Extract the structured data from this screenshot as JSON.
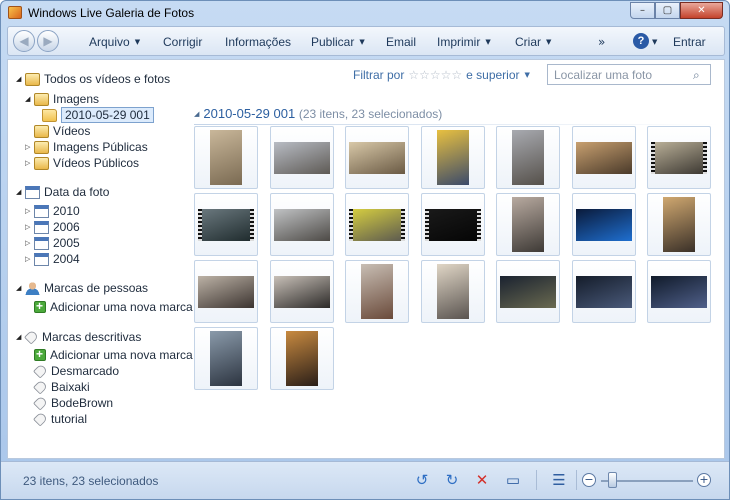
{
  "window": {
    "title": "Windows Live Galeria de Fotos",
    "minimize": "–",
    "maximize": "▢",
    "close": "✕"
  },
  "toolbar": {
    "back": "◀",
    "forward": "▶",
    "menus": [
      {
        "label": "Arquivo",
        "caret": true
      },
      {
        "label": "Corrigir",
        "caret": false
      },
      {
        "label": "Informações",
        "caret": false
      },
      {
        "label": "Publicar",
        "caret": true
      },
      {
        "label": "Email",
        "caret": false
      },
      {
        "label": "Imprimir",
        "caret": true
      },
      {
        "label": "Criar",
        "caret": true
      }
    ],
    "overflow": "»",
    "help": "?",
    "signin": "Entrar"
  },
  "filter": {
    "label": "Filtrar por",
    "stars": "☆☆☆☆☆",
    "qualifier": "e superior"
  },
  "search": {
    "placeholder": "Localizar uma foto"
  },
  "tree": {
    "all": "Todos os vídeos e fotos",
    "images": "Imagens",
    "selected_folder": "2010-05-29 001",
    "videos": "Vídeos",
    "public_images": "Imagens Públicas",
    "public_videos": "Vídeos Públicos",
    "date_header": "Data da foto",
    "years": [
      "2010",
      "2006",
      "2005",
      "2004"
    ],
    "people_header": "Marcas de pessoas",
    "people_add": "Adicionar uma nova marca",
    "desc_header": "Marcas descritivas",
    "desc_add": "Adicionar uma nova marca",
    "desc_tags": [
      "Desmarcado",
      "Baixaki",
      "BodeBrown",
      "tutorial"
    ]
  },
  "group": {
    "title": "2010-05-29 001",
    "subtitle": "(23 itens, 23 selecionados)"
  },
  "thumbnails": [
    {
      "orient": "portrait",
      "video": false,
      "colors": [
        "#c9b79a",
        "#7a6a52"
      ]
    },
    {
      "orient": "landscape",
      "video": false,
      "colors": [
        "#b8bcc4",
        "#5e5a55"
      ]
    },
    {
      "orient": "landscape",
      "video": false,
      "colors": [
        "#d8c8a8",
        "#6a5a44"
      ]
    },
    {
      "orient": "portrait",
      "video": false,
      "colors": [
        "#e8c040",
        "#3b4a6a"
      ]
    },
    {
      "orient": "portrait",
      "video": false,
      "colors": [
        "#a8aab0",
        "#55504a"
      ]
    },
    {
      "orient": "landscape",
      "video": false,
      "colors": [
        "#c8a070",
        "#4a3a2a"
      ]
    },
    {
      "orient": "landscape",
      "video": true,
      "colors": [
        "#bcb29a",
        "#3a3630"
      ]
    },
    {
      "orient": "landscape",
      "video": true,
      "colors": [
        "#6c7a80",
        "#1e2a2c"
      ]
    },
    {
      "orient": "landscape",
      "video": false,
      "colors": [
        "#c0c2c4",
        "#4d4a46"
      ]
    },
    {
      "orient": "landscape",
      "video": true,
      "colors": [
        "#d8d040",
        "#5a5850"
      ]
    },
    {
      "orient": "landscape",
      "video": true,
      "colors": [
        "#1a1a1a",
        "#050505"
      ]
    },
    {
      "orient": "portrait",
      "video": false,
      "colors": [
        "#b8aaa0",
        "#3e3a36"
      ]
    },
    {
      "orient": "landscape",
      "video": false,
      "colors": [
        "#0a1a3a",
        "#1f6fd0"
      ]
    },
    {
      "orient": "portrait",
      "video": false,
      "colors": [
        "#d0a870",
        "#3a3028"
      ]
    },
    {
      "orient": "landscape",
      "video": false,
      "colors": [
        "#bcb2a6",
        "#3c3430"
      ]
    },
    {
      "orient": "landscape",
      "video": false,
      "colors": [
        "#c8c0b8",
        "#2c2a28"
      ]
    },
    {
      "orient": "portrait",
      "video": false,
      "colors": [
        "#c8beb4",
        "#6a4a3a"
      ]
    },
    {
      "orient": "portrait",
      "video": false,
      "colors": [
        "#e0d6c6",
        "#5a5450"
      ]
    },
    {
      "orient": "landscape",
      "video": false,
      "colors": [
        "#1a2230",
        "#6a6a50"
      ]
    },
    {
      "orient": "landscape",
      "video": false,
      "colors": [
        "#141c2a",
        "#4a5a7a"
      ]
    },
    {
      "orient": "landscape",
      "video": false,
      "colors": [
        "#101a2a",
        "#50608a"
      ]
    },
    {
      "orient": "portrait",
      "video": false,
      "colors": [
        "#8a9aaa",
        "#2c3440"
      ]
    },
    {
      "orient": "portrait",
      "video": false,
      "colors": [
        "#c88a40",
        "#2a1e18"
      ]
    }
  ],
  "status": {
    "text": "23 itens, 23 selecionados"
  },
  "statusbar_icons": {
    "rotate_left": "↺",
    "rotate_right": "↻",
    "delete": "✕",
    "slideshow": "▭",
    "details": "☰",
    "zoom_out": "−",
    "zoom_in": "+",
    "colors": {
      "rotate": "#2f6fc4",
      "delete": "#d3302a",
      "slideshow": "#2f5ea0"
    }
  },
  "zoom": {
    "level": 0.12
  }
}
